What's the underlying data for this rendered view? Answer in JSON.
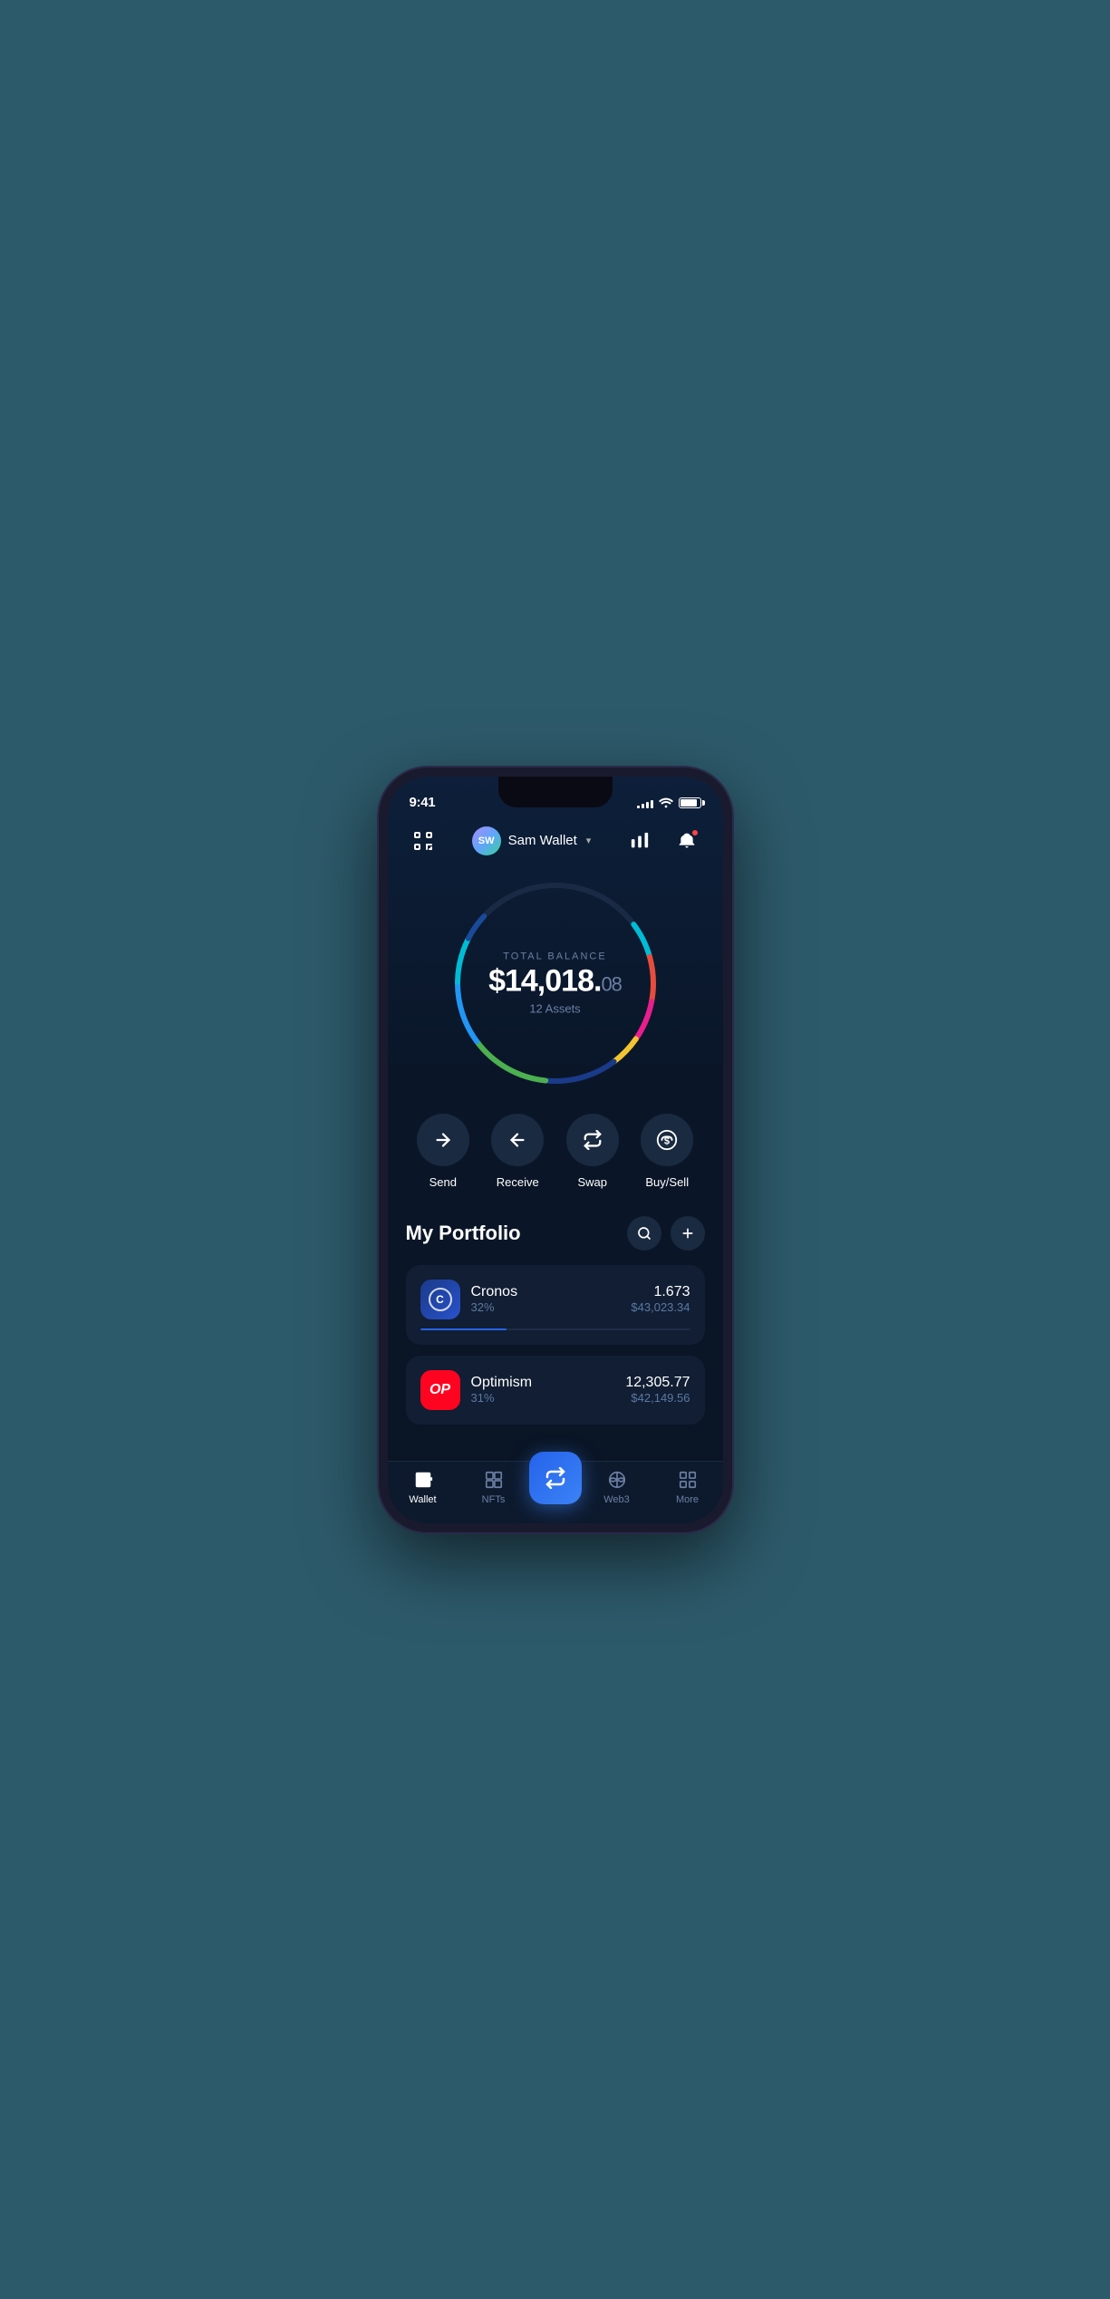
{
  "status": {
    "time": "9:41",
    "signal_bars": [
      3,
      5,
      7,
      9,
      11
    ],
    "battery_pct": 90
  },
  "header": {
    "wallet_initials": "SW",
    "wallet_name": "Sam Wallet",
    "scanner_label": "scanner",
    "chart_label": "chart",
    "bell_label": "notifications"
  },
  "balance": {
    "label": "TOTAL BALANCE",
    "amount_main": "$14,018.",
    "amount_cents": "08",
    "assets_count": "12 Assets"
  },
  "actions": [
    {
      "id": "send",
      "label": "Send",
      "icon": "→"
    },
    {
      "id": "receive",
      "label": "Receive",
      "icon": "←"
    },
    {
      "id": "swap",
      "label": "Swap",
      "icon": "⇅"
    },
    {
      "id": "buysell",
      "label": "Buy/Sell",
      "icon": "$"
    }
  ],
  "portfolio": {
    "title": "My Portfolio",
    "search_label": "search",
    "add_label": "add"
  },
  "assets": [
    {
      "id": "cronos",
      "name": "Cronos",
      "pct": "32%",
      "pct_num": 32,
      "amount": "1.673",
      "usd": "$43,023.34",
      "bar_color": "#2563eb"
    },
    {
      "id": "optimism",
      "name": "Optimism",
      "pct": "31%",
      "pct_num": 31,
      "amount": "12,305.77",
      "usd": "$42,149.56",
      "bar_color": "#ff4444"
    }
  ],
  "bottom_nav": [
    {
      "id": "wallet",
      "label": "Wallet",
      "active": true
    },
    {
      "id": "nfts",
      "label": "NFTs",
      "active": false
    },
    {
      "id": "swap-center",
      "label": "",
      "active": false
    },
    {
      "id": "web3",
      "label": "Web3",
      "active": false
    },
    {
      "id": "more",
      "label": "More",
      "active": false
    }
  ],
  "colors": {
    "accent_blue": "#2563eb",
    "bg_dark": "#0a1628",
    "bg_card": "#111e33",
    "text_muted": "#5a7aa3",
    "circle_segments": [
      "#e74c3c",
      "#e91e8c",
      "#f4c430",
      "#1a75ff",
      "#00bcd4",
      "#2196f3",
      "#4caf50"
    ]
  }
}
